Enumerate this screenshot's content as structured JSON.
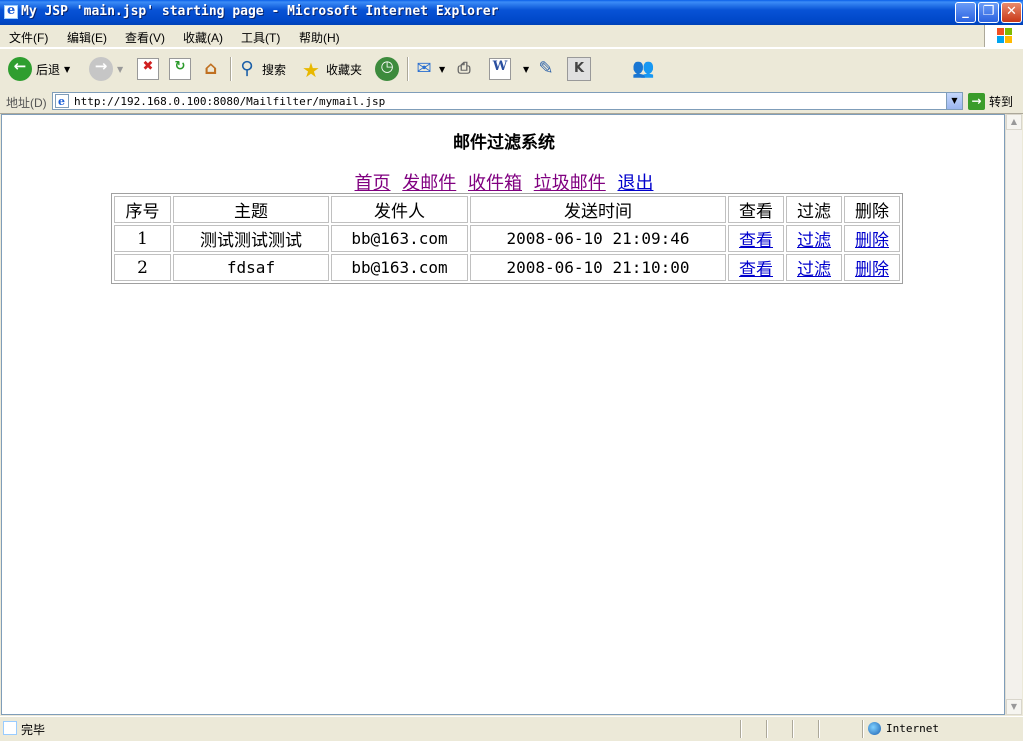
{
  "window": {
    "title": "My JSP 'main.jsp' starting page - Microsoft Internet Explorer",
    "minimize": "_",
    "maximize": "❐",
    "close": "✕"
  },
  "menu": [
    "文件(F)",
    "编辑(E)",
    "查看(V)",
    "收藏(A)",
    "工具(T)",
    "帮助(H)"
  ],
  "toolbar": {
    "back_label": "后退",
    "search_label": "搜索",
    "favorites_label": "收藏夹"
  },
  "address": {
    "label": "地址(D)",
    "url": "http://192.168.0.100:8080/Mailfilter/mymail.jsp",
    "go_label": "转到"
  },
  "page": {
    "title": "邮件过滤系统",
    "nav": [
      "首页",
      "发邮件",
      "收件箱",
      "垃圾邮件",
      "退出"
    ]
  },
  "table": {
    "headers": [
      "序号",
      "主题",
      "发件人",
      "发送时间",
      "查看",
      "过滤",
      "删除"
    ],
    "rows": [
      {
        "no": "1",
        "subject": "测试测试测试",
        "sender": "bb@163.com",
        "time": "2008-06-10 21:09:46",
        "view": "查看",
        "filter": "过滤",
        "delete": "删除"
      },
      {
        "no": "2",
        "subject": "fdsaf",
        "sender": "bb@163.com",
        "time": "2008-06-10 21:10:00",
        "view": "查看",
        "filter": "过滤",
        "delete": "删除"
      }
    ]
  },
  "status": {
    "text": "完毕",
    "zone": "Internet"
  }
}
